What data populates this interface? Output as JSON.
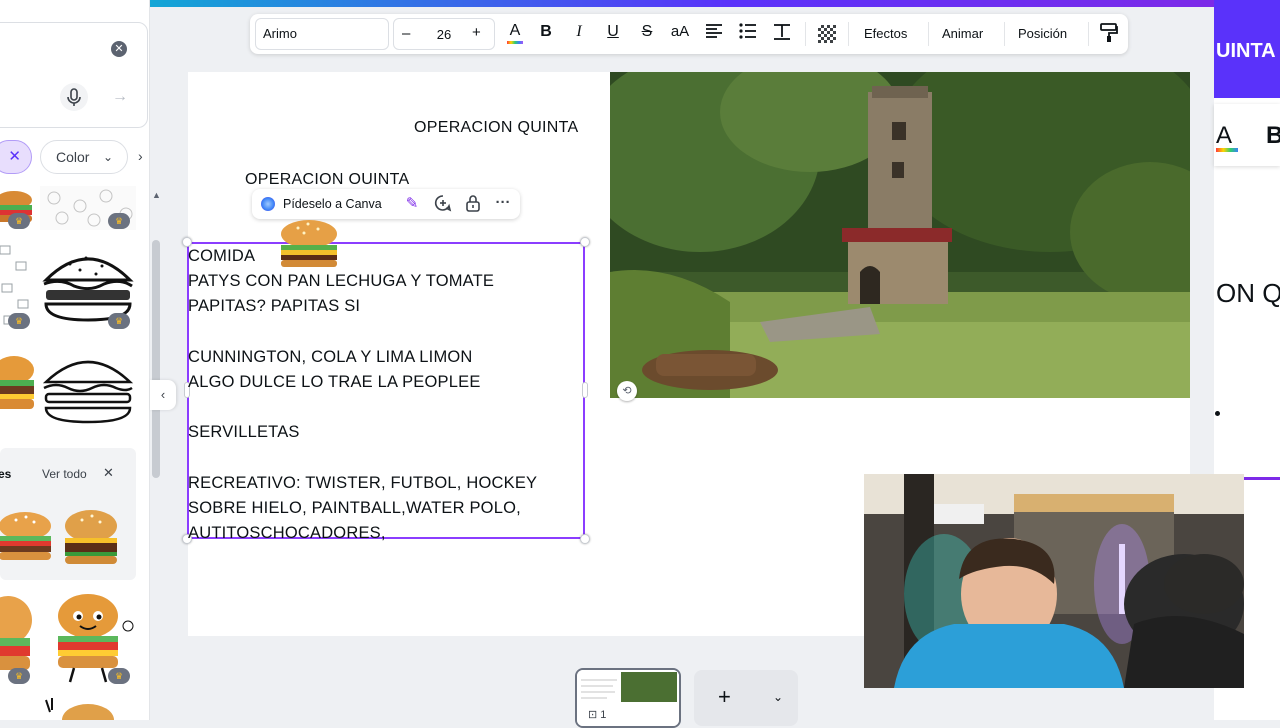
{
  "toolbar": {
    "font": "Arimo",
    "size_minus": "–",
    "font_size": "26",
    "size_plus": "+",
    "effects": "Efectos",
    "animate": "Animar",
    "position": "Posición",
    "case_label": "aA"
  },
  "left_panel": {
    "filter_color": "Color",
    "see_all": "Ver todo",
    "section_partial": "es"
  },
  "canvas": {
    "title_top": "OPERACION QUINTA",
    "title_second": "OPERACION OUINTA",
    "ask_canva": "Pídeselo a Canva",
    "text_lines": [
      "COMIDA",
      "PATYS CON PAN LECHUGA Y TOMATE",
      "PAPITAS? PAPITAS SI",
      "",
      "CUNNINGTON, COLA Y LIMA LIMON",
      "ALGO DULCE LO TRAE LA PEOPLEE",
      "",
      "SERVILLETAS",
      "",
      "RECREATIVO: TWISTER, FUTBOL, HOCKEY",
      "SOBRE HIELO, PAINTBALL,WATER POLO,",
      "AUTITOSCHOCADORES,"
    ]
  },
  "right_strip": {
    "banner_partial": "UINTA",
    "text_partial": "ON QU",
    "toolbar_partial_a": "A",
    "toolbar_partial_b": "B"
  },
  "pages": {
    "page_number": "1"
  },
  "colors": {
    "accent": "#8b3dff",
    "brand_gradient_start": "#00c4cc",
    "brand_gradient_end": "#7d2ae8",
    "spellcheck": "#e2473b"
  }
}
